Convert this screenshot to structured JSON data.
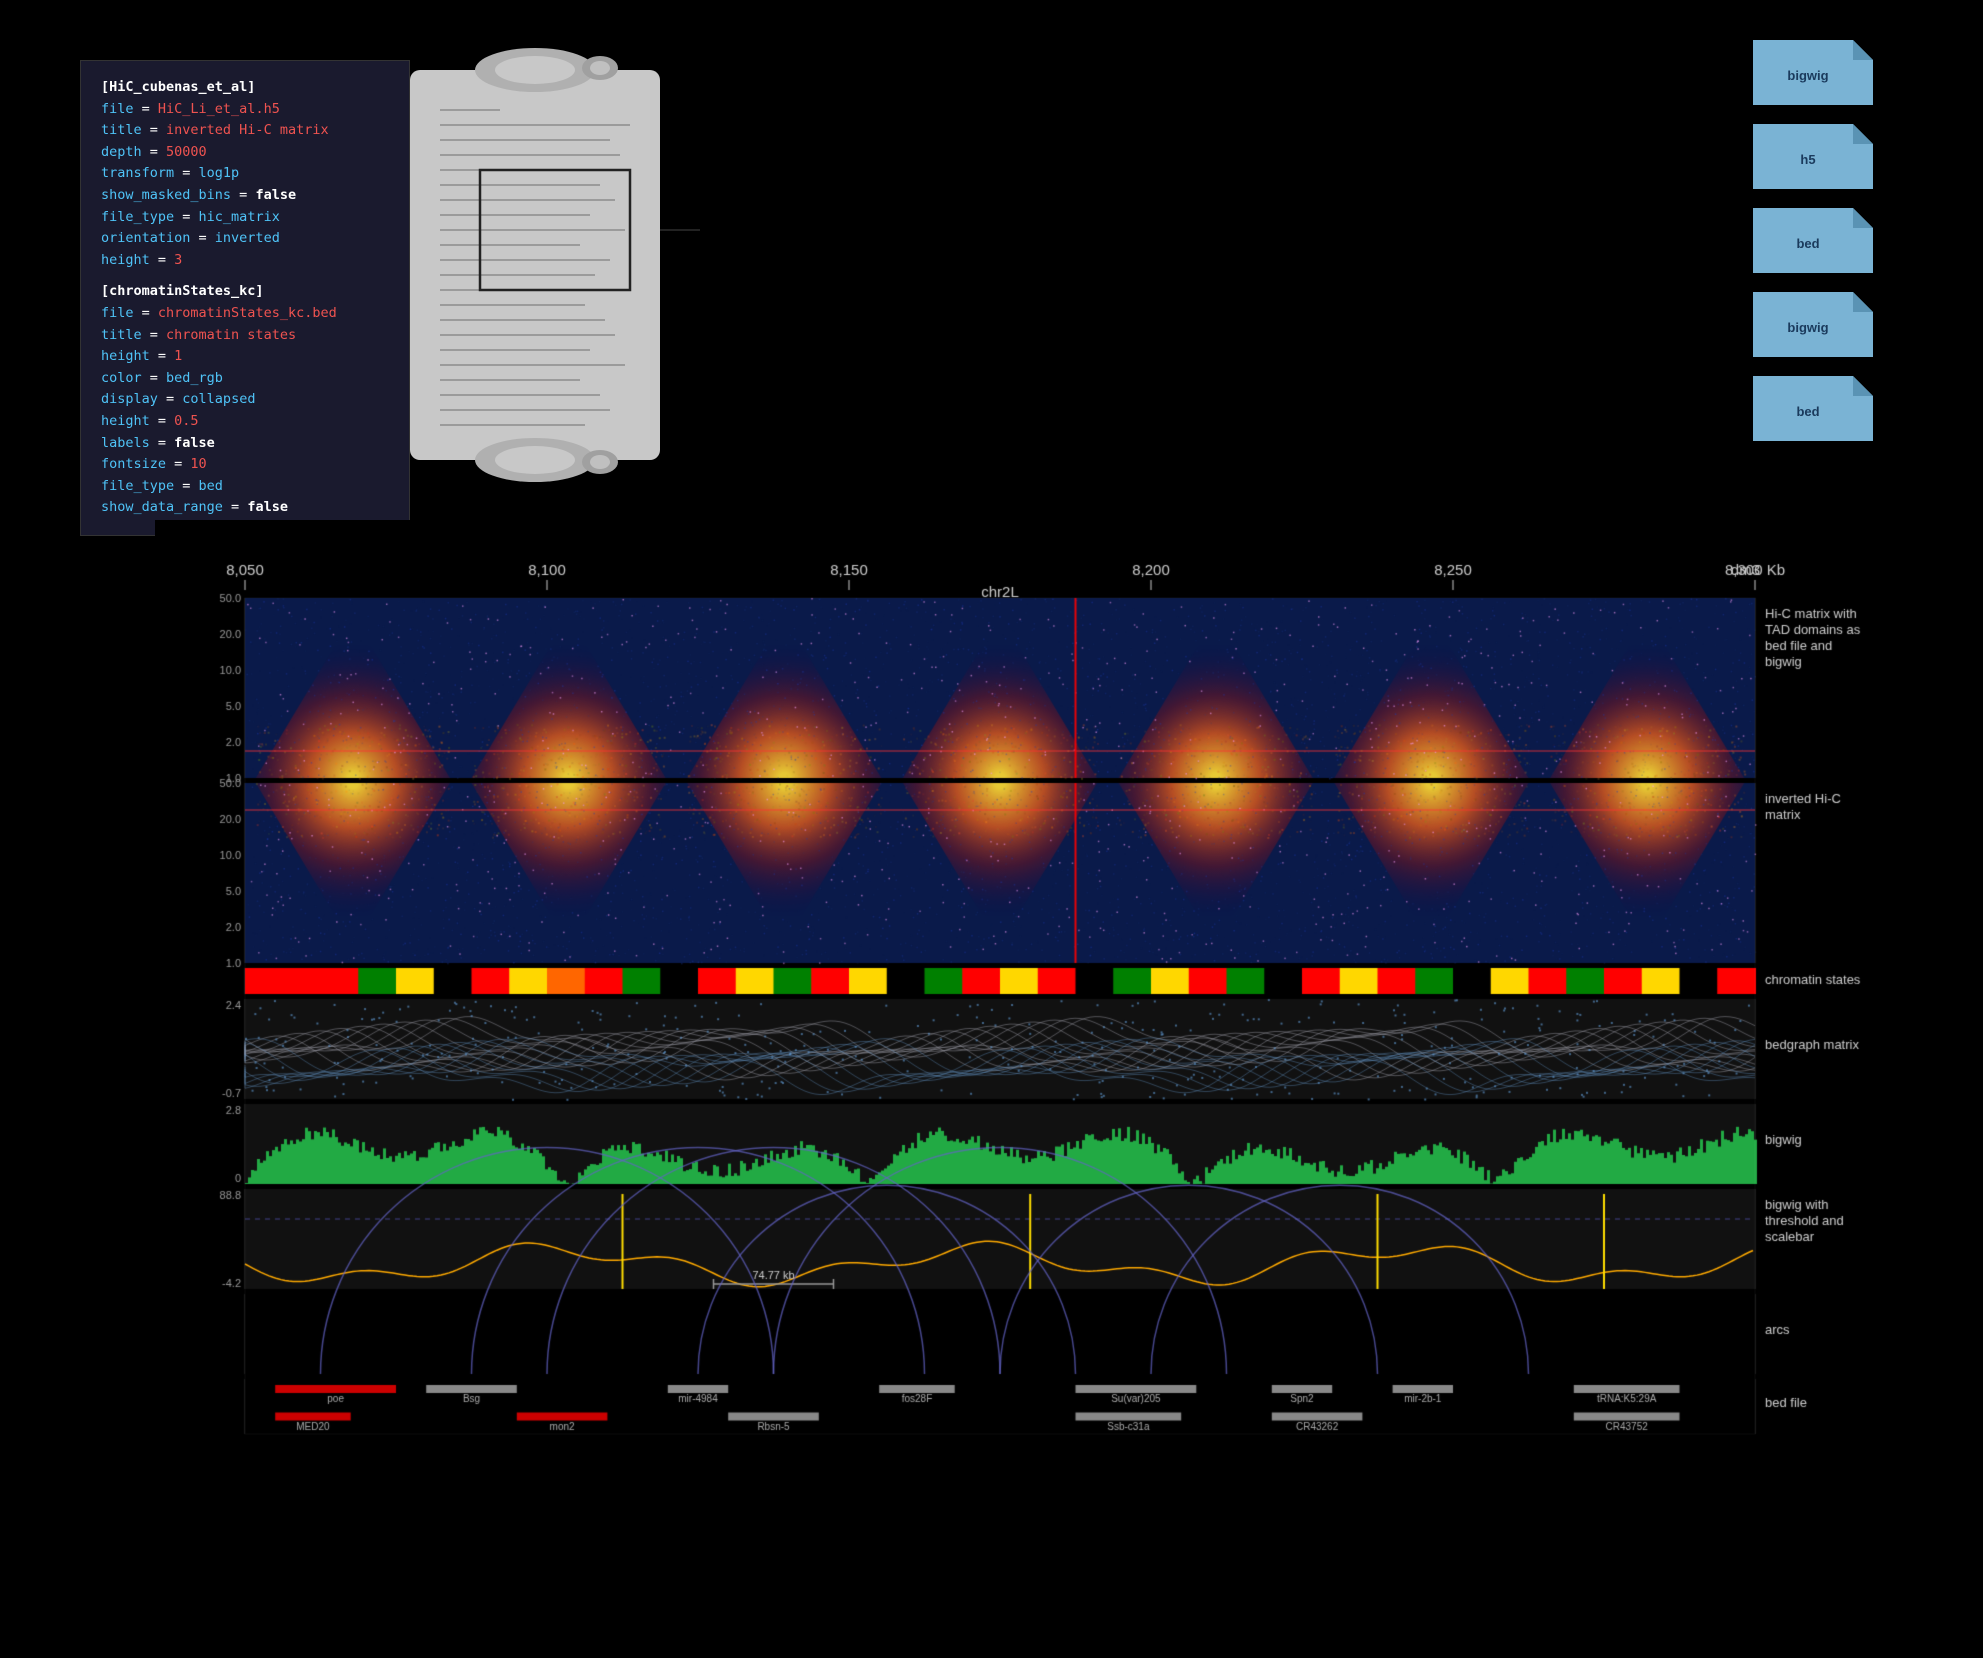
{
  "code_block": {
    "section1": {
      "header": "[HiC_cubenas_et_al]",
      "lines": [
        {
          "key": "file",
          "eq": " = ",
          "val": "HiC_Li_et_al.h5",
          "val_color": "str"
        },
        {
          "key": "title",
          "eq": " = ",
          "val": "inverted Hi-C matrix",
          "val_color": "str"
        },
        {
          "key": "depth",
          "eq": " = ",
          "val": "50000",
          "val_color": "num"
        },
        {
          "key": "transform",
          "eq": " = ",
          "val": "log1p",
          "val_color": "kw"
        },
        {
          "key": "show_masked_bins",
          "eq": " = ",
          "val": "false",
          "val_color": "bool"
        },
        {
          "key": "file_type",
          "eq": " = ",
          "val": "hic_matrix",
          "val_color": "kw"
        },
        {
          "key": "orientation",
          "eq": " = ",
          "val": "inverted",
          "val_color": "kw"
        },
        {
          "key": "height",
          "eq": " = ",
          "val": "3",
          "val_color": "num"
        }
      ]
    },
    "section2": {
      "header": "[chromatinStates_kc]",
      "lines": [
        {
          "key": "file",
          "eq": " = ",
          "val": "chromatinStates_kc.bed",
          "val_color": "str"
        },
        {
          "key": "title",
          "eq": " = ",
          "val": "chromatin states",
          "val_color": "str"
        },
        {
          "key": "height",
          "eq": " = ",
          "val": "1",
          "val_color": "num"
        },
        {
          "key": "color",
          "eq": " = ",
          "val": "bed_rgb",
          "val_color": "kw"
        },
        {
          "key": "display",
          "eq": " = ",
          "val": "collapsed",
          "val_color": "kw"
        },
        {
          "key": "height",
          "eq": " = ",
          "val": "0.5",
          "val_color": "num"
        },
        {
          "key": "labels",
          "eq": " = ",
          "val": "false",
          "val_color": "bool"
        },
        {
          "key": "fontsize",
          "eq": " = ",
          "val": "10",
          "val_color": "num"
        },
        {
          "key": "file_type",
          "eq": " = ",
          "val": "bed",
          "val_color": "kw"
        },
        {
          "key": "show_data_range",
          "eq": " = ",
          "val": "false",
          "val_color": "bool"
        }
      ]
    }
  },
  "file_icons": [
    {
      "label": "bigwig"
    },
    {
      "label": "h5"
    },
    {
      "label": "bed"
    },
    {
      "label": "bigwig"
    },
    {
      "label": "bed"
    }
  ],
  "genome_viz": {
    "axis": {
      "ticks": [
        "8,050",
        "8,100",
        "8,150",
        "8,200",
        "8,250",
        "8,300 Kb"
      ],
      "chromosome": "chr2L",
      "genome": "dm3"
    },
    "tracks": [
      {
        "id": "hic1",
        "label": "Hi-C matrix with TAD domains as bed file and bigwig",
        "y_axis": [
          "50.0",
          "20.0",
          "10.0",
          "5.0",
          "2.0",
          "1.0"
        ]
      },
      {
        "id": "hic2",
        "label": "inverted Hi-C matrix",
        "y_axis": [
          "50.0",
          "20.0",
          "10.0",
          "5.0",
          "2.0",
          "1.0"
        ]
      },
      {
        "id": "chromatin",
        "label": "chromatin states"
      },
      {
        "id": "bedgraph",
        "label": "bedgraph matrix",
        "y_axis": [
          "2.4",
          "-0.7"
        ]
      },
      {
        "id": "bigwig",
        "label": "bigwig",
        "y_axis": [
          "2.8",
          "0"
        ]
      },
      {
        "id": "bigwig_threshold",
        "label": "bigwig with threshold and scalebar",
        "y_axis": [
          "88.8",
          "-4.2"
        ],
        "scalebar": "74.77 kb"
      },
      {
        "id": "arcs",
        "label": "arcs"
      },
      {
        "id": "bed",
        "label": "bed file"
      }
    ],
    "gene_labels": [
      "poe",
      "MED20",
      "Bsg",
      "mon2",
      "mir-4984",
      "Rbsn-5",
      "fos28F",
      "Su(var)205",
      "Ssb-c31a",
      "Spn2",
      "CR43262",
      "mir-2b-1",
      "tRNA:K5:29A",
      "CR43752"
    ]
  }
}
